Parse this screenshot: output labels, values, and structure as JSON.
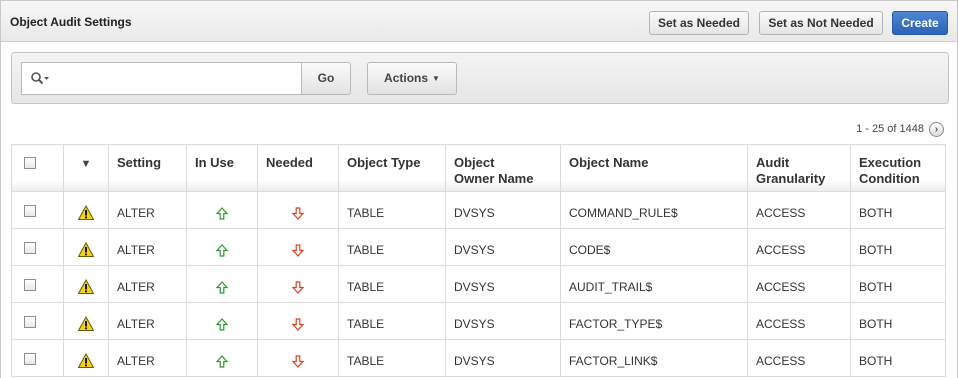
{
  "region": {
    "title": "Object Audit Settings"
  },
  "header_buttons": {
    "set_needed": "Set as Needed",
    "set_not_needed": "Set as Not Needed",
    "create": "Create"
  },
  "search": {
    "value": "",
    "go_label": "Go",
    "actions_label": "Actions"
  },
  "pagination": {
    "text": "1 - 25 of 1448"
  },
  "columns": {
    "setting": "Setting",
    "in_use": "In Use",
    "needed": "Needed",
    "object_type": "Object Type",
    "object_owner_1": "Object",
    "object_owner_2": "Owner Name",
    "object_name": "Object Name",
    "audit_gran_1": "Audit",
    "audit_gran_2": "Granularity",
    "exec_cond_1": "Execution",
    "exec_cond_2": "Condition"
  },
  "rows": [
    {
      "setting": "ALTER",
      "object_type": "TABLE",
      "owner": "DVSYS",
      "object_name": "COMMAND_RULE$",
      "granularity": "ACCESS",
      "condition": "BOTH"
    },
    {
      "setting": "ALTER",
      "object_type": "TABLE",
      "owner": "DVSYS",
      "object_name": "CODE$",
      "granularity": "ACCESS",
      "condition": "BOTH"
    },
    {
      "setting": "ALTER",
      "object_type": "TABLE",
      "owner": "DVSYS",
      "object_name": "AUDIT_TRAIL$",
      "granularity": "ACCESS",
      "condition": "BOTH"
    },
    {
      "setting": "ALTER",
      "object_type": "TABLE",
      "owner": "DVSYS",
      "object_name": "FACTOR_TYPE$",
      "granularity": "ACCESS",
      "condition": "BOTH"
    },
    {
      "setting": "ALTER",
      "object_type": "TABLE",
      "owner": "DVSYS",
      "object_name": "FACTOR_LINK$",
      "granularity": "ACCESS",
      "condition": "BOTH"
    }
  ],
  "icons": {
    "warning": "warning-icon",
    "in_use": "up-arrow-icon",
    "needed": "down-arrow-icon",
    "search": "search-icon",
    "next": "next-page-icon"
  },
  "colors": {
    "create_button": "#2b63b8",
    "up_arrow": "#2e9a2e",
    "down_arrow": "#d8401f",
    "warning": "#f3d21a"
  }
}
